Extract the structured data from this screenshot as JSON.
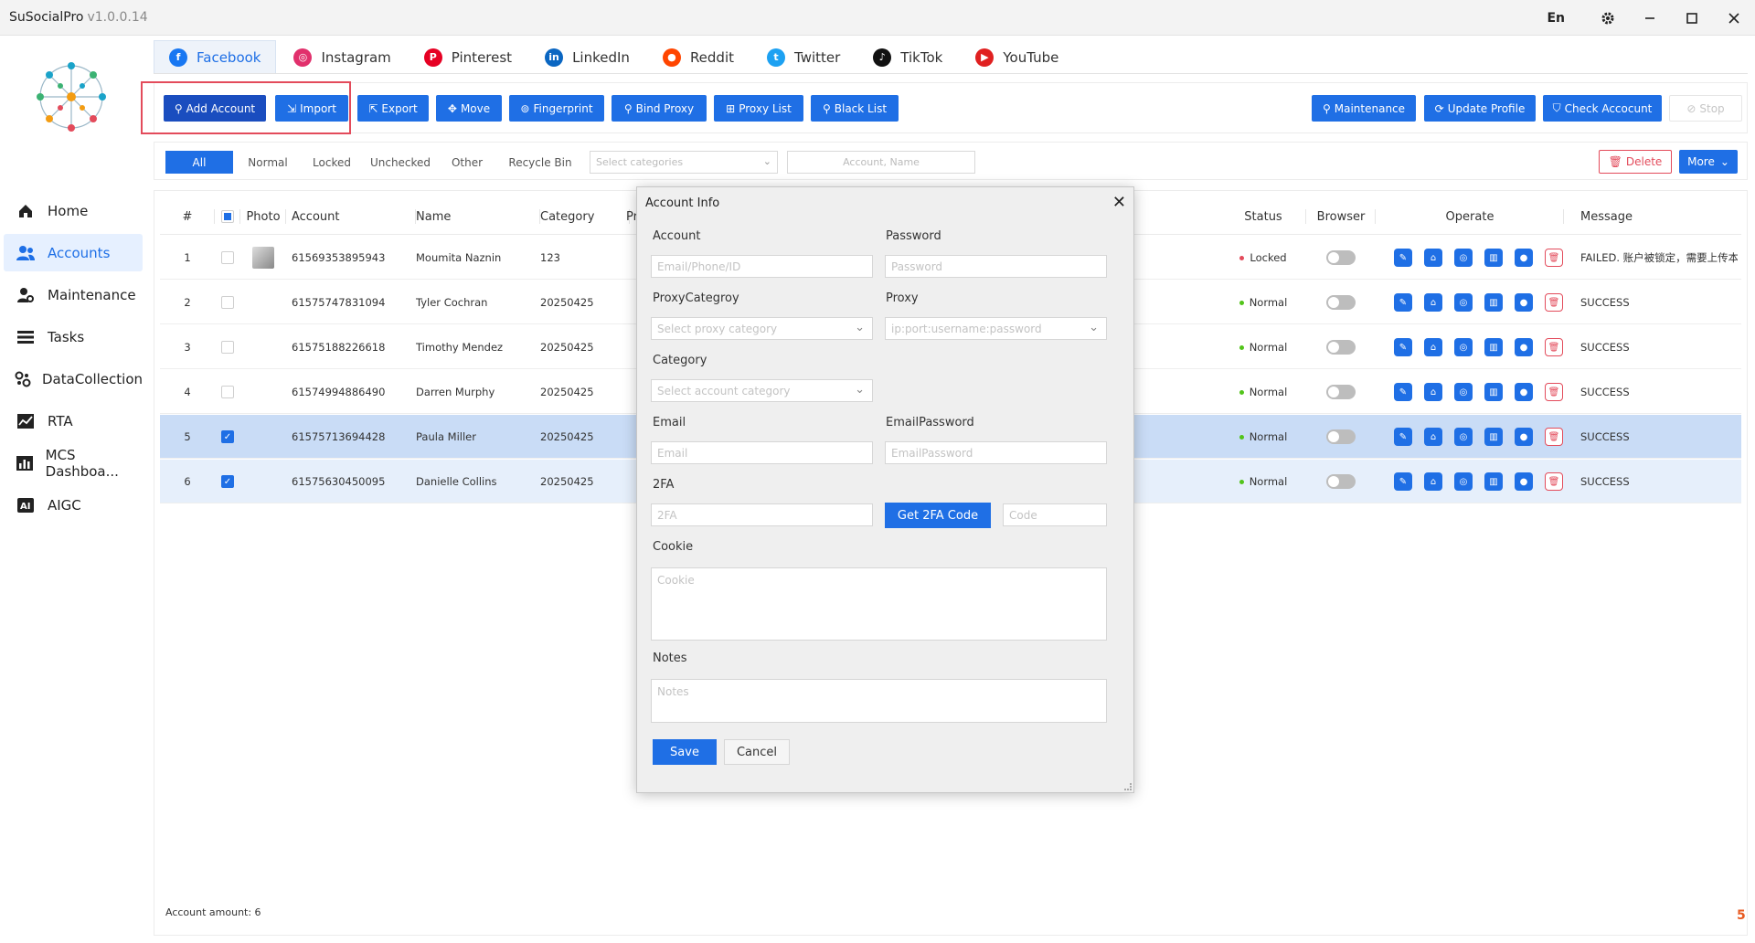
{
  "app": {
    "name": "SuSocialPro",
    "version": "v1.0.0.14",
    "language": "En"
  },
  "sidebar": {
    "items": [
      {
        "label": "Home",
        "icon": "home-icon"
      },
      {
        "label": "Accounts",
        "icon": "accounts-icon",
        "active": true
      },
      {
        "label": "Maintenance",
        "icon": "maintenance-icon"
      },
      {
        "label": "Tasks",
        "icon": "tasks-icon"
      },
      {
        "label": "DataCollection",
        "icon": "data-collection-icon"
      },
      {
        "label": "RTA",
        "icon": "rta-icon"
      },
      {
        "label": "MCS Dashboa...",
        "icon": "dashboard-icon"
      },
      {
        "label": "AIGC",
        "icon": "aigc-icon"
      }
    ]
  },
  "platform_tabs": [
    {
      "label": "Facebook",
      "color": "#1877f2",
      "active": true
    },
    {
      "label": "Instagram",
      "color": "#e1306c"
    },
    {
      "label": "Pinterest",
      "color": "#e60023"
    },
    {
      "label": "LinkedIn",
      "color": "#0a66c2"
    },
    {
      "label": "Reddit",
      "color": "#ff4500"
    },
    {
      "label": "Twitter",
      "color": "#1da1f2"
    },
    {
      "label": "TikTok",
      "color": "#111111"
    },
    {
      "label": "YouTube",
      "color": "#e02020"
    }
  ],
  "toolbar": {
    "add_account": "Add Account",
    "import": "Import",
    "export": "Export",
    "move": "Move",
    "fingerprint": "Fingerprint",
    "bind_proxy": "Bind Proxy",
    "proxy_list": "Proxy List",
    "black_list": "Black List",
    "maintenance": "Maintenance",
    "update_profile": "Update Profile",
    "check_account": "Check Accocunt",
    "stop": "Stop"
  },
  "filters": {
    "tabs": [
      "All",
      "Normal",
      "Locked",
      "Unchecked",
      "Other",
      "Recycle Bin"
    ],
    "category_placeholder": "Select categories",
    "search_placeholder": "Account, Name",
    "delete": "Delete",
    "more": "More"
  },
  "table": {
    "columns": {
      "index": "#",
      "photo": "Photo",
      "account": "Account",
      "name": "Name",
      "category": "Category",
      "pr": "Pr",
      "status": "Status",
      "browser": "Browser",
      "operate": "Operate",
      "message": "Message"
    },
    "rows": [
      {
        "index": "1",
        "account": "61569353895943",
        "name": "Moumita Naznin",
        "category": "123",
        "status": "Locked",
        "status_color": "#e34b5b",
        "message": "FAILED. 账户被锁定，需要上传本人照片",
        "checked": false,
        "photo": true
      },
      {
        "index": "2",
        "account": "61575747831094",
        "name": "Tyler Cochran",
        "category": "20250425",
        "status": "Normal",
        "status_color": "#52c41a",
        "message": "SUCCESS",
        "checked": false
      },
      {
        "index": "3",
        "account": "61575188226618",
        "name": "Timothy Mendez",
        "category": "20250425",
        "status": "Normal",
        "status_color": "#52c41a",
        "message": "SUCCESS",
        "checked": false
      },
      {
        "index": "4",
        "account": "61574994886490",
        "name": "Darren Murphy",
        "category": "20250425",
        "status": "Normal",
        "status_color": "#52c41a",
        "message": "SUCCESS",
        "checked": false
      },
      {
        "index": "5",
        "account": "61575713694428",
        "name": "Paula Miller",
        "category": "20250425",
        "status": "Normal",
        "status_color": "#52c41a",
        "message": "SUCCESS",
        "checked": true
      },
      {
        "index": "6",
        "account": "61575630450095",
        "name": "Danielle Collins",
        "category": "20250425",
        "status": "Normal",
        "status_color": "#52c41a",
        "message": "SUCCESS",
        "checked": true
      }
    ],
    "footer": "Account amount: 6"
  },
  "modal": {
    "title": "Account Info",
    "account_label": "Account",
    "account_placeholder": "Email/Phone/ID",
    "password_label": "Password",
    "password_placeholder": "Password",
    "proxy_category_label": "ProxyCategroy",
    "proxy_category_placeholder": "Select proxy category",
    "proxy_label": "Proxy",
    "proxy_placeholder": "ip:port:username:password",
    "category_label": "Category",
    "category_placeholder": "Select account category",
    "email_label": "Email",
    "email_placeholder": "Email",
    "email_password_label": "EmailPassword",
    "email_password_placeholder": "EmailPassword",
    "twofa_label": "2FA",
    "twofa_placeholder": "2FA",
    "get_2fa": "Get 2FA Code",
    "code_placeholder": "Code",
    "cookie_label": "Cookie",
    "cookie_placeholder": "Cookie",
    "notes_label": "Notes",
    "notes_placeholder": "Notes",
    "save": "Save",
    "cancel": "Cancel"
  }
}
